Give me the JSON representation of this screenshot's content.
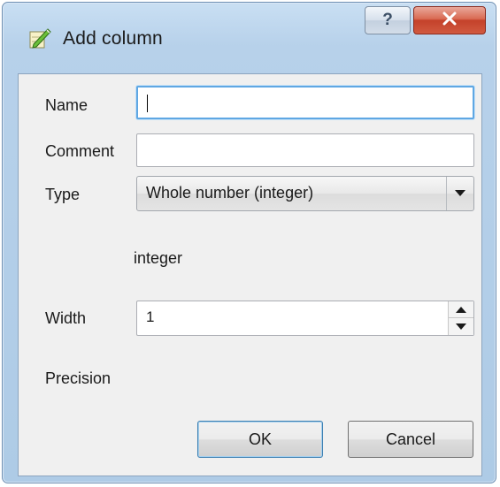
{
  "window": {
    "title": "Add column",
    "help_glyph": "?",
    "app_icon": "qgis-field-icon",
    "close_icon": "close-icon"
  },
  "form": {
    "name_label": "Name",
    "name_value": "",
    "comment_label": "Comment",
    "comment_value": "",
    "type_label": "Type",
    "type_selected": "Whole number (integer)",
    "type_detail": "integer",
    "width_label": "Width",
    "width_value": "1",
    "precision_label": "Precision"
  },
  "buttons": {
    "ok": "OK",
    "cancel": "Cancel"
  },
  "colors": {
    "frame": "#b7d1ea",
    "close_red": "#c4412a",
    "focus_blue": "#5fa7e3"
  }
}
